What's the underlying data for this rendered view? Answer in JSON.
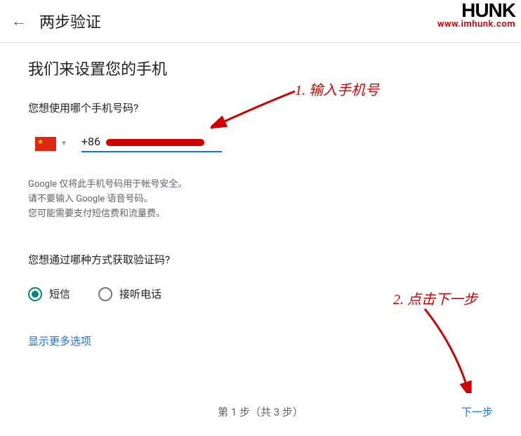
{
  "header": {
    "title": "两步验证"
  },
  "watermark": {
    "logo": "HUNK",
    "url": "www.imhunk.com"
  },
  "main": {
    "title": "我们来设置您的手机",
    "phone_question": "您想使用哪个手机号码?",
    "phone_prefix": "+86",
    "hint_line1": "Google 仅将此手机号码用于帐号安全。",
    "hint_line2": "请不要输入 Google 语音号码。",
    "hint_line3": "您可能需要支付短信费和流量费。",
    "method_question": "您想通过哪种方式获取验证码?",
    "radio_sms": "短信",
    "radio_call": "接听电话",
    "more_options": "显示更多选项"
  },
  "footer": {
    "step_text": "第 1 步（共 3 步）",
    "next": "下一步"
  },
  "annotations": {
    "a1": "1. 输入手机号",
    "a2": "2. 点击下一步"
  }
}
